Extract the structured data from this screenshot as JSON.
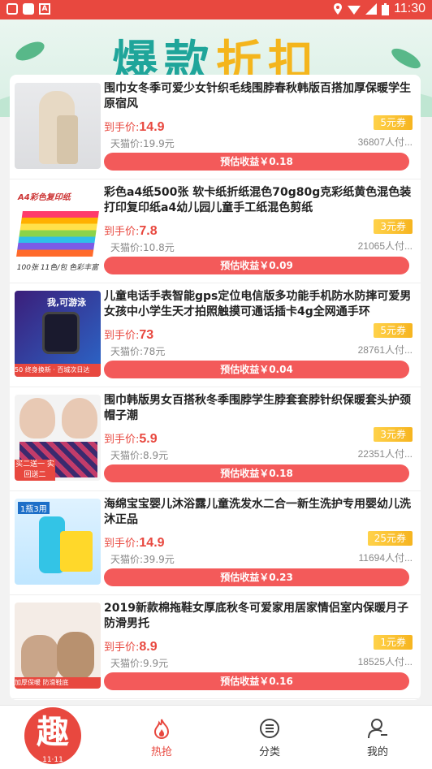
{
  "status_bar": {
    "time": "11:30"
  },
  "banner": {
    "title_part1": "爆款",
    "title_part2": "折扣"
  },
  "products": [
    {
      "title": "围巾女冬季可爱少女针织毛线围脖春秋韩版百搭加厚保暖学生原宿风",
      "price_label": "到手价:",
      "price": "14.9",
      "tmall": "天猫价:19.9元",
      "coupon": "5元券",
      "buyers": "36807人付...",
      "profit": "预估收益￥0.18",
      "thumb_caption": ""
    },
    {
      "title": "彩色a4纸500张 软卡纸折纸混色70g80g克彩纸黄色混色装打印复印纸a4幼儿园儿童手工纸混色剪纸",
      "price_label": "到手价:",
      "price": "7.8",
      "tmall": "天猫价:10.8元",
      "coupon": "3元券",
      "buyers": "21065人付...",
      "profit": "预估收益￥0.09",
      "thumb_caption": "A4彩色复印纸",
      "thumb_footer": "100张 11色/包 色彩丰富"
    },
    {
      "title": "儿童电话手表智能gps定位电信版多功能手机防水防摔可爱男女孩中小学生天才拍照触摸可通话插卡4g全网通手环",
      "price_label": "到手价:",
      "price": "73",
      "tmall": "天猫价:78元",
      "coupon": "5元券",
      "buyers": "28761人付...",
      "profit": "预估收益￥0.04",
      "thumb_caption": "我,可游泳",
      "thumb_footer": "50 终身换新 · 百城次日达"
    },
    {
      "title": "围巾韩版男女百搭秋冬季围脖学生脖套套脖针织保暖套头护颈帽子潮",
      "price_label": "到手价:",
      "price": "5.9",
      "tmall": "天猫价:8.9元",
      "coupon": "3元券",
      "buyers": "22351人付...",
      "profit": "预估收益￥0.18",
      "thumb_caption": "买二送一 实回送二"
    },
    {
      "title": "海绵宝宝婴儿沐浴露儿童洗发水二合一新生洗护专用婴幼儿洗沐正品",
      "price_label": "到手价:",
      "price": "14.9",
      "tmall": "天猫价:39.9元",
      "coupon": "25元券",
      "buyers": "11694人付...",
      "profit": "预估收益￥0.23",
      "thumb_caption": "1瓶3用"
    },
    {
      "title": "2019新款棉拖鞋女厚底秋冬可爱家用居家情侣室内保暖月子防滑男托",
      "price_label": "到手价:",
      "price": "8.9",
      "tmall": "天猫价:9.9元",
      "coupon": "1元券",
      "buyers": "18525人付...",
      "profit": "预估收益￥0.16",
      "thumb_caption": "加厚保暖 防滑鞋底"
    }
  ],
  "nav": {
    "logo": "趣",
    "logo_sub": "11·11",
    "items": [
      {
        "label": "热抢"
      },
      {
        "label": "分类"
      },
      {
        "label": "我的"
      }
    ]
  }
}
